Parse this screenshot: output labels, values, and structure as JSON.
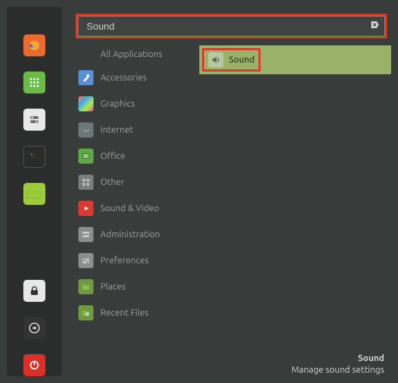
{
  "search": {
    "value": "Sound"
  },
  "categories": {
    "all": "All Applications",
    "items": [
      {
        "label": "Accessories"
      },
      {
        "label": "Graphics"
      },
      {
        "label": "Internet"
      },
      {
        "label": "Office"
      },
      {
        "label": "Other"
      },
      {
        "label": "Sound & Video"
      },
      {
        "label": "Administration"
      },
      {
        "label": "Preferences"
      },
      {
        "label": "Places"
      },
      {
        "label": "Recent Files"
      }
    ]
  },
  "result": {
    "label": "Sound"
  },
  "footer": {
    "title": "Sound",
    "desc": "Manage sound settings"
  }
}
